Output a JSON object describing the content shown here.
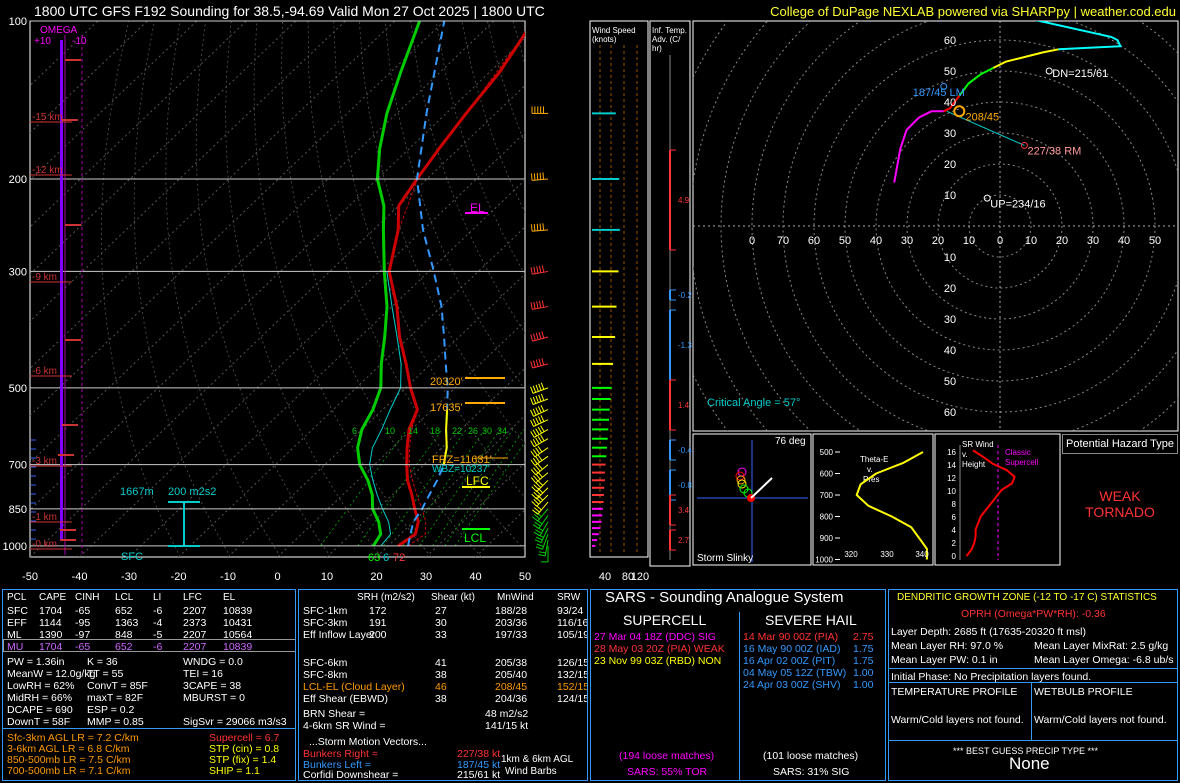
{
  "header": {
    "title_left": "1800 UTC GFS F192 Sounding for 38.5,-94.69 Valid  Mon 27 Oct 2025 | 1800 UTC",
    "title_right": "College of DuPage NEXLAB powered via SHARPpy | weather.cod.edu"
  },
  "skewt": {
    "pressure_levels": [
      100,
      200,
      300,
      500,
      700,
      850,
      1000
    ],
    "temp_ticks": [
      -50,
      -40,
      -30,
      -20,
      -10,
      0,
      10,
      20,
      30,
      40,
      50
    ],
    "height_labels": [
      "15 km",
      "12 km",
      "9 km",
      "6 km",
      "3 km",
      "1 km",
      "0 km"
    ],
    "omega_label": "OMEGA",
    "omega_ticks": [
      "+10",
      "-10"
    ],
    "labels": {
      "el": "EL",
      "lfc": "LFC",
      "lcl": "LCL",
      "frz": "FRZ=11631'",
      "wbz": "WBZ=10237'",
      "h1": "20320'",
      "h2": "17635'",
      "eff_height": "1667m",
      "eff_srh": "200 m2s2",
      "sfc": "SFC",
      "sfc_td": "63",
      "sfc_wb": "6",
      "sfc_t": "72"
    },
    "mixing_ratio_labels": [
      "6",
      "10",
      "14",
      "18",
      "22",
      "26",
      "30",
      "34"
    ],
    "chart_data": {
      "type": "line",
      "xlabel": "",
      "ylabel": "",
      "series": [
        {
          "name": "temperature",
          "points": [
            [
              1000,
              22
            ],
            [
              950,
              23
            ],
            [
              900,
              21
            ],
            [
              850,
              17.5
            ],
            [
              800,
              14
            ],
            [
              750,
              10
            ],
            [
              700,
              6.5
            ],
            [
              650,
              3
            ],
            [
              600,
              -0.5
            ],
            [
              550,
              -3
            ],
            [
              500,
              -9
            ],
            [
              450,
              -15
            ],
            [
              400,
              -22
            ],
            [
              350,
              -29
            ],
            [
              300,
              -38
            ],
            [
              250,
              -45
            ],
            [
              225,
              -50
            ],
            [
              200,
              -52
            ],
            [
              175,
              -54
            ],
            [
              150,
              -56
            ],
            [
              125,
              -58
            ],
            [
              100,
              -62
            ]
          ]
        },
        {
          "name": "dewpoint",
          "points": [
            [
              1000,
              17
            ],
            [
              950,
              16
            ],
            [
              900,
              13
            ],
            [
              850,
              9
            ],
            [
              800,
              6
            ],
            [
              750,
              2
            ],
            [
              700,
              -3
            ],
            [
              650,
              -7
            ],
            [
              600,
              -10
            ],
            [
              550,
              -12
            ],
            [
              500,
              -15
            ],
            [
              450,
              -20
            ],
            [
              400,
              -25
            ],
            [
              350,
              -31
            ],
            [
              300,
              -39
            ],
            [
              250,
              -48
            ],
            [
              225,
              -53
            ],
            [
              200,
              -60
            ],
            [
              175,
              -66
            ],
            [
              150,
              -72
            ],
            [
              125,
              -78
            ],
            [
              100,
              -85
            ]
          ]
        },
        {
          "name": "virtual",
          "points": [
            [
              1000,
              24
            ],
            [
              950,
              25
            ],
            [
              900,
              22.5
            ],
            [
              850,
              19
            ],
            [
              800,
              15
            ],
            [
              750,
              11
            ],
            [
              700,
              7
            ],
            [
              650,
              3.5
            ],
            [
              600,
              0
            ],
            [
              550,
              -2.8
            ],
            [
              500,
              -8.8
            ],
            [
              450,
              -14.9
            ],
            [
              400,
              -21.9
            ],
            [
              350,
              -28.9
            ],
            [
              300,
              -37.9
            ],
            [
              250,
              -44.9
            ],
            [
              200,
              -51.9
            ],
            [
              150,
              -55.9
            ],
            [
              100,
              -61.9
            ]
          ]
        },
        {
          "name": "wetbulb",
          "points": [
            [
              1000,
              18.5
            ],
            [
              950,
              18
            ],
            [
              900,
              15
            ],
            [
              850,
              11
            ],
            [
              800,
              7
            ],
            [
              750,
              3
            ],
            [
              700,
              -1
            ],
            [
              650,
              -4
            ],
            [
              600,
              -6
            ],
            [
              550,
              -8.5
            ],
            [
              500,
              -11
            ],
            [
              450,
              -16
            ],
            [
              400,
              -22.5
            ],
            [
              350,
              -30
            ],
            [
              300,
              -38.5
            ]
          ]
        },
        {
          "name": "parcel",
          "points": [
            [
              1000,
              24
            ],
            [
              950,
              22
            ],
            [
              900,
              20
            ],
            [
              850,
              19
            ],
            [
              800,
              17.5
            ],
            [
              750,
              16
            ],
            [
              700,
              14
            ],
            [
              650,
              11
            ],
            [
              600,
              7
            ],
            [
              550,
              3
            ],
            [
              500,
              -1.5
            ],
            [
              450,
              -7
            ],
            [
              400,
              -13
            ],
            [
              350,
              -20
            ],
            [
              300,
              -29
            ],
            [
              250,
              -40
            ],
            [
              200,
              -52
            ],
            [
              150,
              -64
            ],
            [
              100,
              -80
            ]
          ]
        }
      ],
      "winds": [
        [
          1000,
          180,
          10
        ],
        [
          975,
          190,
          15
        ],
        [
          950,
          200,
          20
        ],
        [
          925,
          205,
          25
        ],
        [
          900,
          210,
          28
        ],
        [
          875,
          215,
          30
        ],
        [
          850,
          220,
          32
        ],
        [
          825,
          220,
          34
        ],
        [
          800,
          225,
          35
        ],
        [
          775,
          225,
          36
        ],
        [
          750,
          225,
          38
        ],
        [
          725,
          230,
          38
        ],
        [
          700,
          230,
          40
        ],
        [
          675,
          235,
          42
        ],
        [
          650,
          235,
          44
        ],
        [
          625,
          240,
          46
        ],
        [
          600,
          240,
          48
        ],
        [
          575,
          245,
          50
        ],
        [
          550,
          245,
          52
        ],
        [
          525,
          250,
          55
        ],
        [
          500,
          250,
          58
        ],
        [
          450,
          255,
          62
        ],
        [
          400,
          255,
          68
        ],
        [
          350,
          260,
          72
        ],
        [
          300,
          260,
          78
        ],
        [
          250,
          265,
          82
        ],
        [
          200,
          265,
          80
        ],
        [
          150,
          270,
          70
        ],
        [
          100,
          270,
          30
        ]
      ]
    }
  },
  "wind_speed": {
    "title": "Wind Speed (knots)",
    "ticks": [
      "40",
      "80",
      "120"
    ]
  },
  "inf_temp": {
    "title": "Inf. Temp. Adv. (C/hr)",
    "values": [
      "4.9",
      "-0.2",
      "-1.3",
      "1.4",
      "-0.4",
      "-0.8",
      "3.4",
      "2.7"
    ]
  },
  "hodograph": {
    "rings": [
      "10",
      "20",
      "30",
      "40",
      "50",
      "60"
    ],
    "x_ticks": [
      "0",
      "70",
      "60",
      "50",
      "40",
      "30",
      "20",
      "10",
      "0",
      "10",
      "20",
      "30",
      "40",
      "50",
      "60",
      "70",
      "8"
    ],
    "labels": {
      "dn": "DN=215/61",
      "lm": "187/45 LM",
      "mean": "208/45",
      "rm": "227/38 RM",
      "up": "UP=234/16"
    },
    "critical_angle": "Critical Angle = 57°",
    "chart_data": {
      "type": "line",
      "points": [
        [
          -18,
          14
        ],
        [
          -16,
          25
        ],
        [
          -14,
          31
        ],
        [
          -10,
          35
        ],
        [
          -6,
          37
        ],
        [
          -2,
          37
        ],
        [
          0,
          38
        ],
        [
          3,
          42
        ],
        [
          6,
          46
        ],
        [
          10,
          49
        ],
        [
          14,
          51
        ],
        [
          18,
          53
        ],
        [
          22,
          54
        ],
        [
          26,
          55
        ],
        [
          30,
          56
        ],
        [
          35,
          57
        ],
        [
          55,
          58
        ],
        [
          54,
          60
        ],
        [
          52,
          61
        ],
        [
          25,
          67
        ]
      ]
    }
  },
  "slinky": {
    "title": "Storm Slinky",
    "deg": "76 deg"
  },
  "thetae": {
    "title": "Theta-E v. Pres",
    "p_ticks": [
      "500",
      "600",
      "700",
      "800",
      "900",
      "1000"
    ],
    "x_ticks": [
      "320",
      "330",
      "340"
    ],
    "chart_data": {
      "type": "line",
      "points": [
        [
          500,
          338
        ],
        [
          550,
          333
        ],
        [
          600,
          326
        ],
        [
          650,
          322
        ],
        [
          700,
          321
        ],
        [
          750,
          324
        ],
        [
          800,
          330
        ],
        [
          850,
          335
        ],
        [
          900,
          337
        ],
        [
          950,
          339
        ],
        [
          1000,
          339
        ]
      ]
    }
  },
  "srwind": {
    "title": "SR Wind v. Height",
    "y_ticks": [
      "16",
      "14",
      "12",
      "10",
      "8",
      "6",
      "4",
      "2",
      "0"
    ],
    "note": "Classic Supercell",
    "chart_data": {
      "type": "line",
      "points": [
        [
          0,
          5
        ],
        [
          0.5,
          7
        ],
        [
          1,
          9
        ],
        [
          2,
          11
        ],
        [
          3,
          12
        ],
        [
          4,
          12
        ],
        [
          5,
          14
        ],
        [
          6,
          16
        ],
        [
          7,
          20
        ],
        [
          8,
          24
        ],
        [
          9,
          28
        ],
        [
          10,
          32
        ],
        [
          11,
          40
        ],
        [
          12,
          42
        ],
        [
          13,
          36
        ],
        [
          14,
          25
        ],
        [
          15,
          18
        ],
        [
          16,
          10
        ]
      ]
    }
  },
  "hazard": {
    "title": "Potential Hazard Type",
    "value_line1": "WEAK",
    "value_line2": "TORNADO"
  },
  "thermo": {
    "headers": [
      "PCL",
      "CAPE",
      "CINH",
      "LCL",
      "LI",
      "LFC",
      "EL"
    ],
    "rows": [
      {
        "pcl": "SFC",
        "cape": "1704",
        "cinh": "-65",
        "lcl": "652",
        "li": "-6",
        "lfc": "2207",
        "el": "10839"
      },
      {
        "pcl": "EFF",
        "cape": "1144",
        "cinh": "-95",
        "lcl": "1363",
        "li": "-4",
        "lfc": "2373",
        "el": "10431"
      },
      {
        "pcl": "ML",
        "cape": "1390",
        "cinh": "-97",
        "lcl": "848",
        "li": "-5",
        "lfc": "2207",
        "el": "10564"
      },
      {
        "pcl": "MU",
        "cape": "1704",
        "cinh": "-65",
        "lcl": "652",
        "li": "-6",
        "lfc": "2207",
        "el": "10839"
      }
    ],
    "col1": [
      "PW = 1.36in",
      "MeanW = 12.0g/kg",
      "LowRH = 62%",
      "MidRH = 66%",
      "DCAPE = 690",
      "DownT = 58F"
    ],
    "col2": [
      "K = 36",
      "TT = 55",
      "ConvT = 85F",
      "maxT = 82F",
      "ESP = 0.2",
      "MMP = 0.85"
    ],
    "col3": [
      "WNDG = 0.0",
      "TEI = 16",
      "3CAPE = 38",
      "MBURST = 0",
      "",
      "SigSvr = 29066 m3/s3"
    ],
    "lapse": [
      "Sfc-3km AGL LR = 7.2 C/km",
      "3-6km AGL LR = 6.8 C/km",
      "850-500mb LR = 7.5 C/km",
      "700-500mb LR = 7.1 C/km"
    ],
    "indices": [
      "Supercell = 6.7",
      "STP (cin) = 0.8",
      "STP (fix) = 1.4",
      "SHIP = 1.1"
    ]
  },
  "kinematic": {
    "headers": [
      "SRH (m2/s2)",
      "Shear (kt)",
      "MnWind",
      "SRW"
    ],
    "rows": [
      [
        "SFC-1km",
        "172",
        "27",
        "188/28",
        "93/24"
      ],
      [
        "SFC-3km",
        "191",
        "30",
        "203/36",
        "116/16"
      ],
      [
        "Eff Inflow Layer",
        "200",
        "33",
        "197/33",
        "105/19"
      ],
      [
        "",
        "",
        "",
        "",
        ""
      ],
      [
        "SFC-6km",
        "",
        "41",
        "205/38",
        "126/15"
      ],
      [
        "SFC-8km",
        "",
        "38",
        "205/40",
        "132/15"
      ],
      [
        "LCL-EL (Cloud Layer)",
        "",
        "46",
        "208/45",
        "152/15"
      ],
      [
        "Eff Shear (EBWD)",
        "",
        "38",
        "204/36",
        "124/15"
      ]
    ],
    "brn": [
      "BRN Shear =",
      "48 m2/s2"
    ],
    "sr46": [
      "4-6km SR Wind =",
      "141/15 kt"
    ],
    "motion_title": "...Storm Motion Vectors...",
    "motion": [
      [
        "Bunkers Right =",
        "227/38 kt"
      ],
      [
        "Bunkers Left =",
        "187/45 kt"
      ],
      [
        "Corfidi Downshear =",
        "215/61 kt"
      ],
      [
        "Corfidi Upshear =",
        "234/16 kt"
      ]
    ],
    "barb_label": "1km & 6km AGL Wind Barbs"
  },
  "sars": {
    "title": "SARS - Sounding Analogue System",
    "super_title": "SUPERCELL",
    "hail_title": "SEVERE HAIL",
    "super_rows": [
      "27 Mar 04 18Z (DDC) SIG",
      "28 May 03 20Z (PIA)  WEAK",
      "23 Nov 99 03Z (RBD) NON"
    ],
    "hail_rows": [
      [
        "14 Mar 90 00Z (PIA)",
        "2.75"
      ],
      [
        "16 May 90 00Z (IAD)",
        "1.75"
      ],
      [
        "16 Apr 02 00Z (PIT)",
        "1.75"
      ],
      [
        "04 May 05 12Z (TBW)",
        "1.00"
      ],
      [
        "24 Apr 03 00Z (SHV)",
        "1.00"
      ]
    ],
    "super_matches": "(194 loose matches)",
    "super_prob": "SARS: 55% TOR",
    "hail_matches": "(101 loose matches)",
    "hail_prob": "SARS: 31% SIG"
  },
  "dgz": {
    "title": "DENDRITIC GROWTH ZONE (-12 TO -17 C) STATISTICS",
    "oprh": "OPRH (Omega*PW*RH): -0.36",
    "depth": "Layer Depth: 2685 ft (17635-20320 ft msl)",
    "rh": "Mean Layer RH: 97.0 %",
    "mixrat": "Mean Layer MixRat: 2.5 g/kg",
    "pw": "Mean Layer PW: 0.1 in",
    "omega": "Mean Layer Omega: -6.8 ub/s",
    "init": "Initial Phase:  No Precipitation layers found.",
    "temp_title": "TEMPERATURE PROFILE",
    "wb_title": "WETBULB PROFILE",
    "temp_val": "Warm/Cold layers not found.",
    "wb_val": "Warm/Cold layers not found.",
    "precip_title": "*** BEST GUESS PRECIP TYPE ***",
    "precip_val": "None"
  }
}
